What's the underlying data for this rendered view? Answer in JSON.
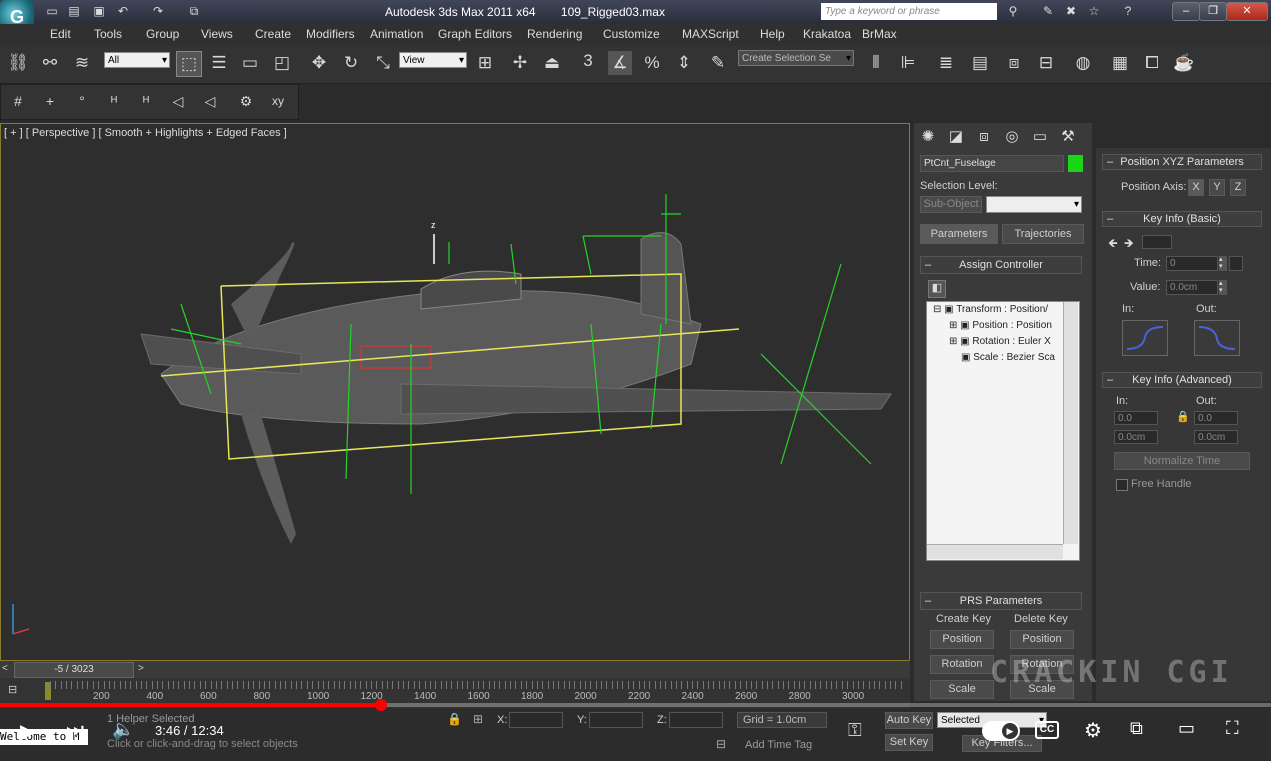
{
  "window": {
    "app_title": "Autodesk 3ds Max  2011 x64",
    "file_name": "109_Rigged03.max",
    "search_placeholder": "Type a keyword or phrase"
  },
  "menu": [
    "Edit",
    "Tools",
    "Group",
    "Views",
    "Create",
    "Modifiers",
    "Animation",
    "Graph Editors",
    "Rendering",
    "Customize",
    "MAXScript",
    "Help",
    "Krakatoa",
    "BrMax"
  ],
  "toolbar": {
    "selection_filter": "All",
    "ref_coord": "View",
    "named_selection": "Create Selection Se",
    "snap_number": "3"
  },
  "viewport": {
    "label": "[ + ] [ Perspective ] [ Smooth + Highlights + Edged Faces ]"
  },
  "command_panel": {
    "object_name": "PtCnt_Fuselage",
    "object_color": "#19d419",
    "selection_level_label": "Selection Level:",
    "sub_object_label": "Sub-Object",
    "tab_parameters": "Parameters",
    "tab_trajectories": "Trajectories",
    "assign_controller_title": "Assign Controller",
    "tree": [
      "Transform : Position/",
      "Position : Position",
      "Rotation : Euler X",
      "Scale : Bezier Sca"
    ],
    "prs_title": "PRS Parameters",
    "create_key": "Create Key",
    "delete_key": "Delete Key",
    "create_buttons": [
      "Position",
      "Rotation",
      "Scale"
    ],
    "delete_buttons": [
      "Position",
      "Rotation",
      "Scale"
    ]
  },
  "right_panel": {
    "pos_xyz_title": "Position XYZ Parameters",
    "position_axis_label": "Position Axis:",
    "axes": [
      "X",
      "Y",
      "Z"
    ],
    "key_info_basic_title": "Key Info (Basic)",
    "time_label": "Time:",
    "time_value": "0",
    "value_label": "Value:",
    "value_value": "0.0cm",
    "in_label": "In:",
    "out_label": "Out:",
    "key_info_adv_title": "Key Info (Advanced)",
    "adv_in": "In:",
    "adv_out": "Out:",
    "adv_in_1": "0.0",
    "adv_out_1": "0.0",
    "adv_in_2": "0.0cm",
    "adv_out_2": "0.0cm",
    "normalize_time": "Normalize Time",
    "free_handle": "Free Handle"
  },
  "timeline": {
    "frame_counter": "-5 / 3023",
    "ticks": [
      "200",
      "400",
      "600",
      "800",
      "1000",
      "1200",
      "1400",
      "1600",
      "1800",
      "2000",
      "2200",
      "2400",
      "2600",
      "2800",
      "3000"
    ]
  },
  "status": {
    "selected": "1 Helper Selected",
    "prompt": "Click or click-and-drag to select objects",
    "x_label": "X:",
    "y_label": "Y:",
    "z_label": "Z:",
    "grid": "Grid = 1.0cm",
    "add_time_tag": "Add Time Tag",
    "auto_key": "Auto Key",
    "set_key": "Set Key",
    "selected_dropdown": "Selected",
    "key_filters": "Key Filters..."
  },
  "video": {
    "time_current": "3:46",
    "time_total": "12:34",
    "time_display": "3:46 / 12:34",
    "progress_fraction": 0.3,
    "caption_snippet": "Welcome to M",
    "cc_label": "CC"
  },
  "watermark": "CRACKIN CGI"
}
